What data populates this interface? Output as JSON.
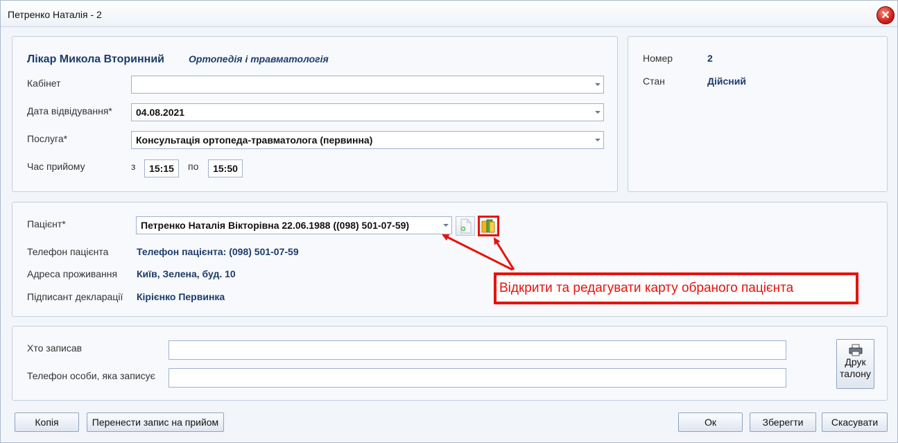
{
  "window": {
    "title": "Петренко Наталія - 2",
    "close_glyph": "✕"
  },
  "doctor": {
    "name": "Лікар Микола Вторинний",
    "specialty": "Ортопедія і травматологія"
  },
  "form": {
    "cabinet_label": "Кабінет",
    "cabinet_value": "",
    "date_label": "Дата відвідування*",
    "date_value": "04.08.2021",
    "service_label": "Послуга*",
    "service_value": "Консультація ортопеда-травматолога (первинна)",
    "time_label": "Час прийому",
    "time_from_label": "з",
    "time_from": "15:15",
    "time_to_label": "по",
    "time_to": "15:50"
  },
  "info": {
    "number_label": "Номер",
    "number_value": "2",
    "state_label": "Стан",
    "state_value": "Дійсний"
  },
  "patient": {
    "label": "Пацієнт*",
    "value": "Петренко Наталія Вікторівна 22.06.1988 ((098) 501-07-59)",
    "phone_label": "Телефон пацієнта",
    "phone_value": "Телефон пацієнта: (098) 501-07-59",
    "address_label": "Адреса проживання",
    "address_value": "Київ, Зелена, буд. 10",
    "signer_label": "Підписант декларації",
    "signer_value": "Кірієнко Первинка"
  },
  "annotation": {
    "text": "Відкрити та редагувати карту обраного пацієнта",
    "color": "#e8120c"
  },
  "recorder": {
    "who_label": "Хто записав",
    "who_value": "",
    "phone_label": "Телефон особи, яка записує",
    "phone_value": "",
    "print_line1": "Друк",
    "print_line2": "талону"
  },
  "footer": {
    "copy": "Копія",
    "move": "Перенести запис на прийом",
    "ok": "Ок",
    "save": "Зберегти",
    "cancel": "Скасувати"
  }
}
